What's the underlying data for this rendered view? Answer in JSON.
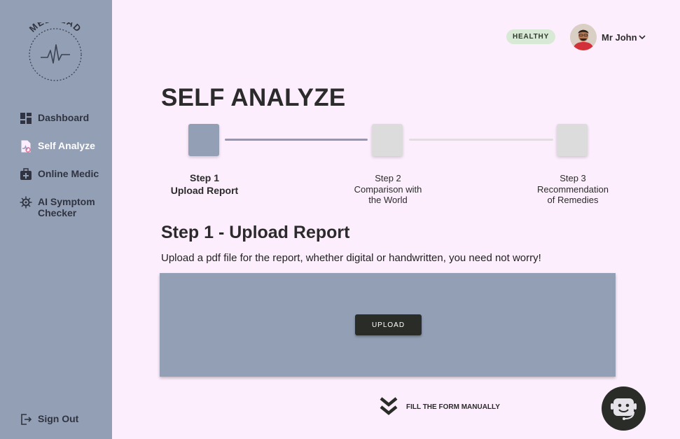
{
  "app": {
    "logo_text": "MEDHEAD"
  },
  "sidebar": {
    "items": [
      {
        "label": "Dashboard",
        "icon": "dashboard-icon",
        "active": false
      },
      {
        "label": "Self Analyze",
        "icon": "self-analyze-icon",
        "active": true
      },
      {
        "label": "Online Medic",
        "icon": "medical-kit-icon",
        "active": false
      },
      {
        "label": "AI Symptom Checker",
        "line1": "AI Symptom",
        "line2": "Checker",
        "icon": "virus-icon",
        "active": false
      }
    ],
    "sign_out": {
      "label": "Sign Out",
      "icon": "sign-out-icon"
    }
  },
  "header": {
    "status_badge": "HEALTHY",
    "user_name": "Mr John",
    "user_menu_icon": "chevron-down-icon"
  },
  "main": {
    "title": "SELF ANALYZE",
    "steps": [
      {
        "number": "Step 1",
        "name": "Upload Report",
        "active": true
      },
      {
        "number": "Step 2",
        "name_line1": "Comparison with",
        "name_line2": "the World",
        "active": false
      },
      {
        "number": "Step 3",
        "name_line1": "Recommendation",
        "name_line2": "of Remedies",
        "active": false
      }
    ],
    "section_title": "Step 1 - Upload Report",
    "section_description": "Upload a pdf file for the report, whether digital or handwritten, you need not worry!",
    "upload_button": "UPLOAD",
    "manual_link": "FILL THE FORM MANUALLY",
    "chat_icon": "chatbot-icon"
  },
  "colors": {
    "background": "#fdeefd",
    "sidebar": "#929fb5",
    "dark": "#2a2d27",
    "badge": "#d8ead6",
    "step_active": "#929fb5",
    "step_inactive": "#dcdcdc"
  }
}
